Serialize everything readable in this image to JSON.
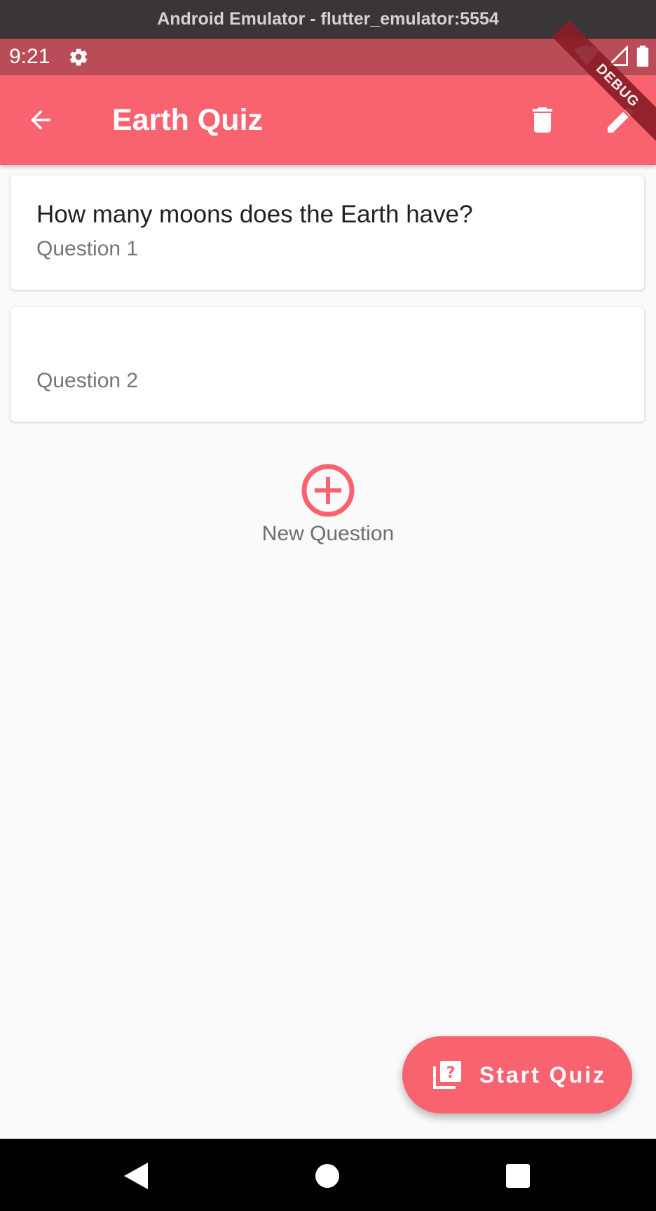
{
  "window": {
    "title": "Android Emulator - flutter_emulator:5554"
  },
  "status_bar": {
    "time": "9:21",
    "icons": [
      "settings-icon",
      "wifi-icon",
      "signal-icon",
      "battery-icon"
    ]
  },
  "app_bar": {
    "title": "Earth Quiz",
    "actions": [
      "back-arrow-icon",
      "delete-icon",
      "edit-icon"
    ],
    "debug_banner": "DEBUG"
  },
  "questions": [
    {
      "text": "How many moons does the Earth have?",
      "label": "Question 1"
    },
    {
      "text": "",
      "label": "Question 2"
    }
  ],
  "new_question": {
    "label": "New Question",
    "icon": "add-circle-icon"
  },
  "fab": {
    "label": "Start Quiz",
    "icon": "quiz-icon"
  },
  "nav_bar": {
    "buttons": [
      "back-triangle-icon",
      "home-circle-icon",
      "recents-square-icon"
    ]
  },
  "colors": {
    "primary": "#f9626f",
    "status_bar": "#b94c57",
    "background": "#fafafa"
  }
}
